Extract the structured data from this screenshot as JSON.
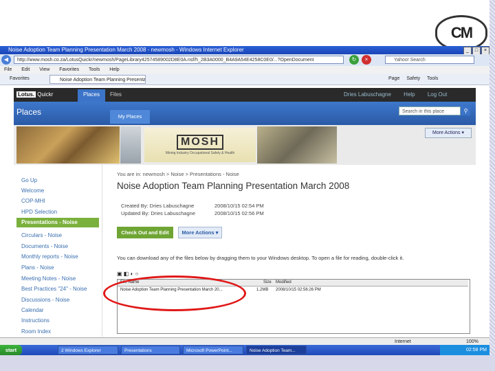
{
  "logo": {
    "text": "CM"
  },
  "browser": {
    "title": "Noise Adoption Team Planning Presentation March 2008 - newmosh - Windows Internet Explorer",
    "address": "http://www.mosh.co.za/LotusQuickr/newmosh/PageLibrary42574589002D8E0A.nsf/h_2B3A0000_B4A9A54E4258C0E0/...?OpenDocument",
    "search_placeholder": "Yahoo! Search",
    "menu": [
      "File",
      "Edit",
      "View",
      "Favorites",
      "Tools",
      "Help"
    ],
    "favorites_label": "Favorites",
    "tab_label": "Noise Adoption Team Planning Presentation March 20...",
    "tools": [
      "Page",
      "Safety",
      "Tools"
    ],
    "status_zone": "Internet",
    "zoom": "100%"
  },
  "quickr": {
    "brand": "Lotus.",
    "brand_suffix": "Quickr",
    "tab_places": "Places",
    "tab_files": "Files",
    "header_links": [
      "Dries Labuschagne",
      "Help",
      "Log Out"
    ],
    "places_title": "Places",
    "my_places": "My Places",
    "search_placeholder": "Search in this place",
    "more_actions_top": "More Actions ▾",
    "banner_logo": "MOSH",
    "banner_sub": "Mining Industry Occupational Safety & Health"
  },
  "nav": {
    "items": [
      "Go Up",
      "Welcome",
      "COP-MHI",
      "HPD Selection"
    ],
    "active": "Presentations - Noise",
    "items_after": [
      "Circulars - Noise",
      "Documents - Noise",
      "Monthly reports - Noise",
      "Plans - Noise",
      "Meeting Notes - Noise",
      "Best Practices \"24\" - Noise",
      "Discussions - Noise",
      "Calendar",
      "Instructions",
      "Room Index"
    ]
  },
  "main": {
    "breadcrumb": "You are in: newmosh > Noise > Presentations - Noise",
    "title": "Noise Adoption Team Planning Presentation March 2008",
    "created_label": "Created By: Dries Labuschagne",
    "created_date": "2008/10/15 02:54 PM",
    "updated_label": "Updated By: Dries Labuschagne",
    "updated_date": "2008/10/15 02:56 PM",
    "checkout_btn": "Check Out and Edit",
    "more_actions_btn": "More Actions ▾",
    "drag_note": "You can download any of the files below by dragging them to your Windows desktop. To open a file for reading, double-click it.",
    "table_headers": [
      "File Name",
      "Size",
      "Modified"
    ],
    "file_row": {
      "name": "Noise Adoption Team Planning Presentation March 20...",
      "size": "1.2MB",
      "date": "2008/10/15 02:56:26 PM"
    }
  },
  "taskbar": {
    "start": "start",
    "items": [
      "2 Windows Explorer",
      "Presentations",
      "Microsoft PowerPoint...",
      "Noise Adoption Team..."
    ],
    "time": "02:58 PM"
  }
}
